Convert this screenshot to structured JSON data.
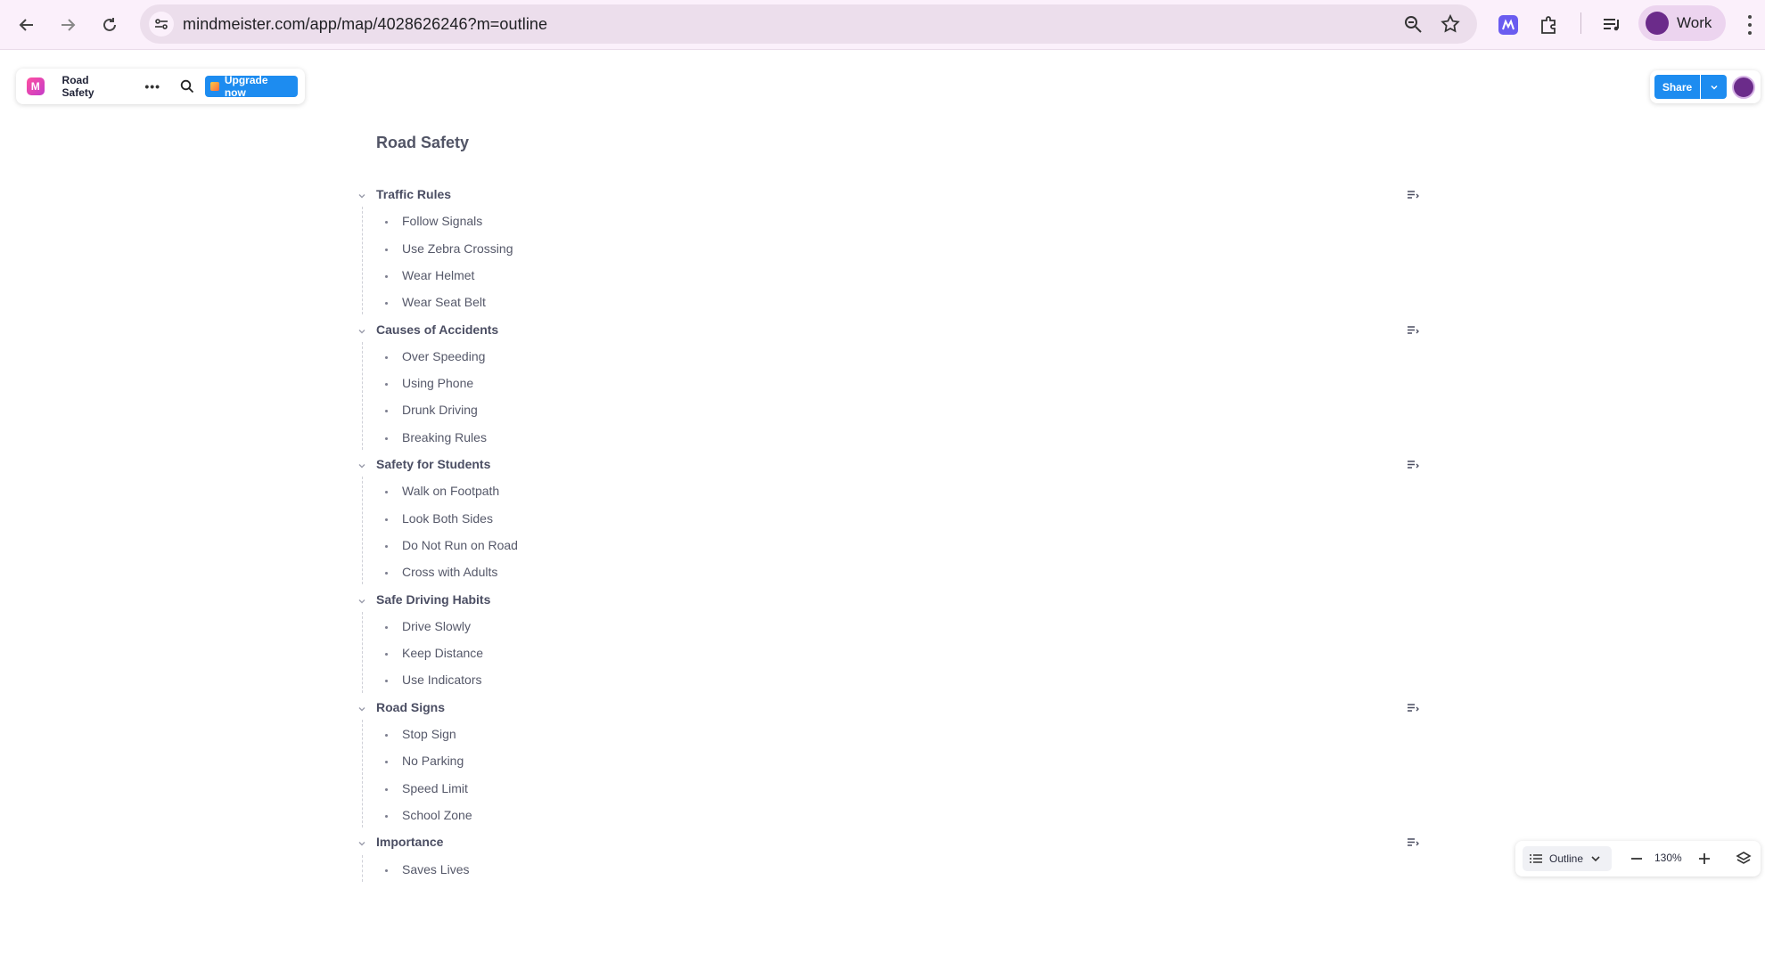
{
  "browser": {
    "url": "mindmeister.com/app/map/4028626246?m=outline",
    "profile_label": "Work"
  },
  "toolbar": {
    "logo": "M",
    "map_title": "Road Safety",
    "more": "•••",
    "upgrade_label": "Upgrade now",
    "share_label": "Share"
  },
  "outline": {
    "title": "Road Safety",
    "topics": [
      {
        "label": "Traffic Rules",
        "has_note": true,
        "children": [
          "Follow Signals",
          "Use Zebra Crossing",
          "Wear Helmet",
          "Wear Seat Belt"
        ]
      },
      {
        "label": "Causes of Accidents",
        "has_note": true,
        "children": [
          "Over Speeding",
          "Using Phone",
          "Drunk Driving",
          "Breaking Rules"
        ]
      },
      {
        "label": "Safety for Students",
        "has_note": true,
        "children": [
          "Walk on Footpath",
          "Look Both Sides",
          "Do Not Run on Road",
          "Cross with Adults"
        ]
      },
      {
        "label": "Safe Driving Habits",
        "has_note": false,
        "children": [
          "Drive Slowly",
          "Keep Distance",
          "Use Indicators"
        ]
      },
      {
        "label": "Road Signs",
        "has_note": true,
        "children": [
          "Stop Sign",
          "No Parking",
          "Speed Limit",
          "School Zone"
        ]
      },
      {
        "label": "Importance",
        "has_note": true,
        "children": [
          "Saves Lives"
        ]
      }
    ]
  },
  "bottom_controls": {
    "view_mode": "Outline",
    "zoom": "130%"
  },
  "colors": {
    "accent": "#1d8cf0",
    "chrome_bg": "#fbf0fb",
    "text": "#4b4e63"
  }
}
